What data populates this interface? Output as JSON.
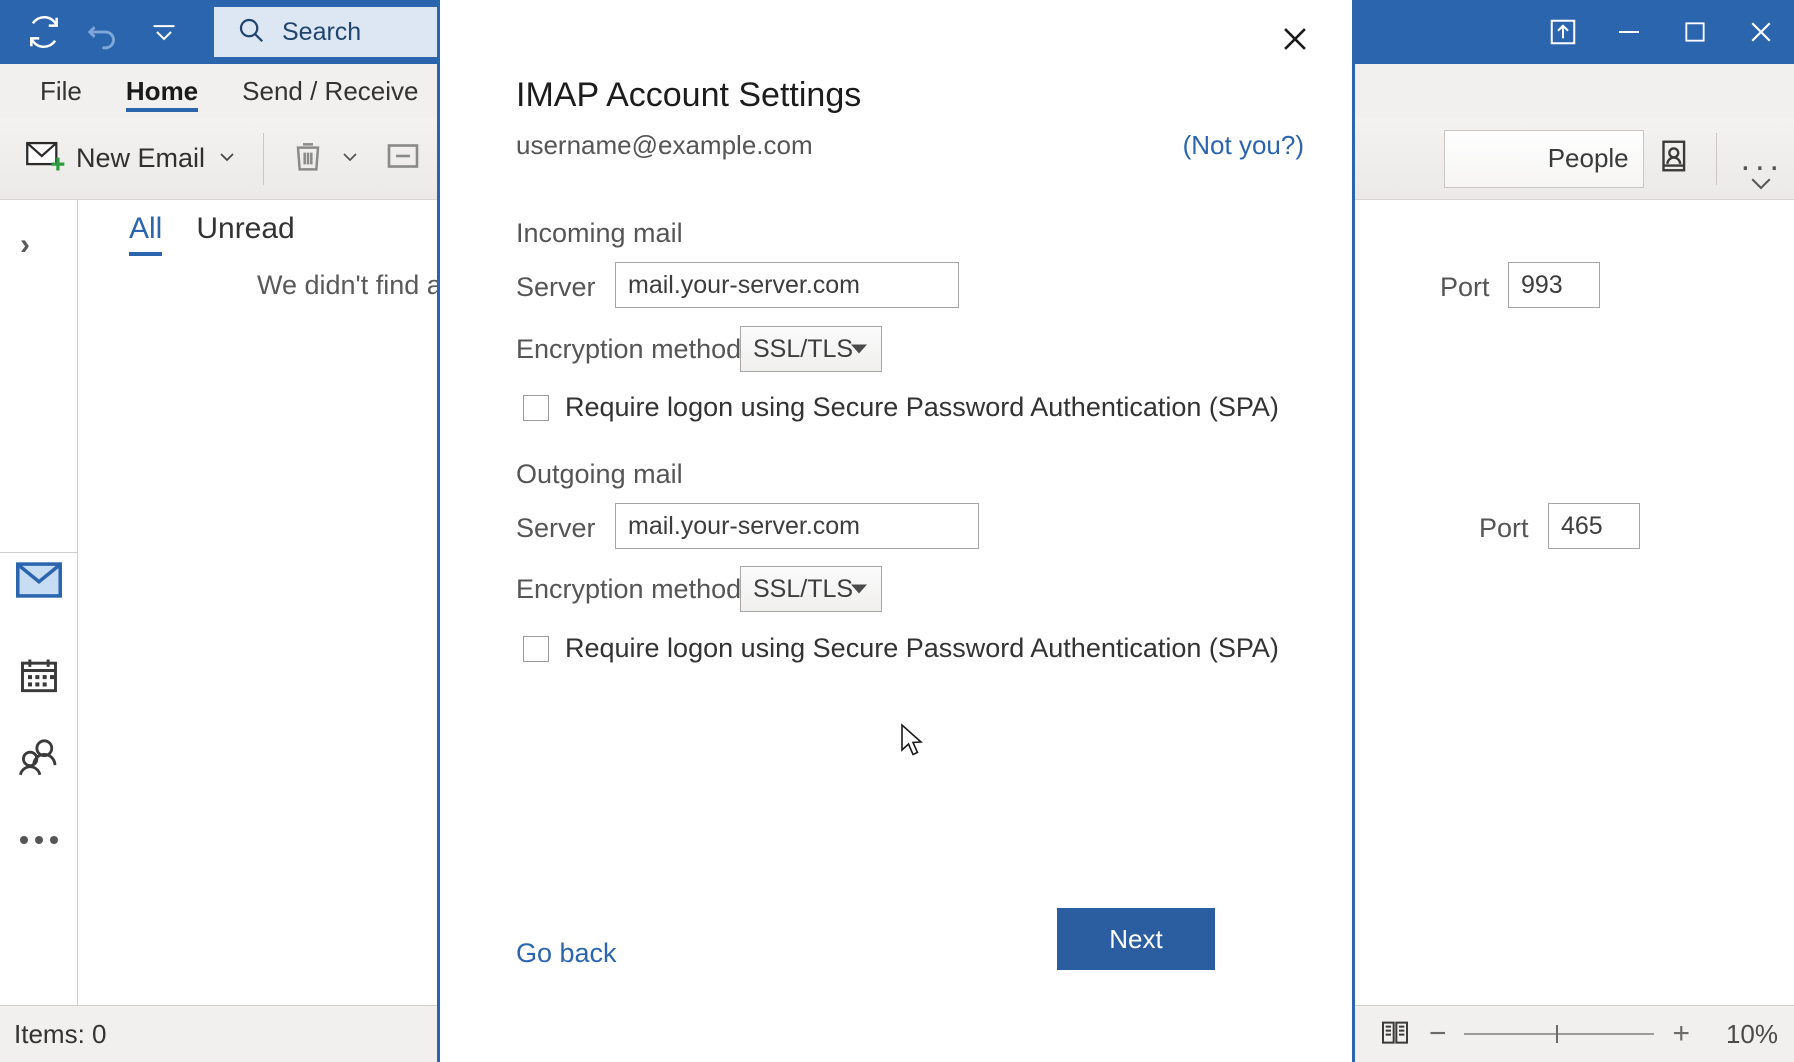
{
  "titlebar": {
    "quick_access": [
      {
        "name": "send-receive-all-icon",
        "label": "Send/Receive All Folders"
      },
      {
        "name": "undo-icon",
        "label": "Undo"
      },
      {
        "name": "customize-quick-access-toolbar-icon",
        "label": "Customize Quick Access Toolbar"
      }
    ],
    "search": {
      "placeholder": "Search",
      "value": "Search"
    },
    "window_controls": [
      {
        "name": "restore-down-ribbon-icon",
        "label": "Ribbon Display Options"
      },
      {
        "name": "minimize-icon",
        "label": "Minimize"
      },
      {
        "name": "maximize-icon",
        "label": "Maximize"
      },
      {
        "name": "close-icon",
        "label": "Close"
      }
    ]
  },
  "ribbon": {
    "tabs": [
      {
        "label": "File",
        "active": false
      },
      {
        "label": "Home",
        "active": true
      },
      {
        "label": "Send / Receive",
        "active": false
      }
    ],
    "new_email_label": "New Email",
    "people_label": "People",
    "overflow_label": "..."
  },
  "navrail": {
    "expand_label": "›",
    "items": [
      {
        "name": "mail-icon",
        "label": "Mail",
        "selected": true
      },
      {
        "name": "calendar-icon",
        "label": "Calendar",
        "selected": false
      },
      {
        "name": "people-icon",
        "label": "People",
        "selected": false
      },
      {
        "name": "more-options-icon",
        "label": "More",
        "selected": false
      }
    ]
  },
  "list_pane": {
    "filters": [
      {
        "label": "All",
        "active": true
      },
      {
        "label": "Unread",
        "active": false
      }
    ],
    "empty_message": "We didn't find anything to s"
  },
  "statusbar": {
    "items_label": "Items: 0",
    "reading_view_icon": "reading-view-icon",
    "zoom_minus": "−",
    "zoom_plus": "+",
    "zoom_level": "10%"
  },
  "dialog": {
    "close_label": "✕",
    "title": "IMAP Account Settings",
    "account_email": "username@example.com",
    "not_you_label": "(Not you?)",
    "incoming": {
      "section_label": "Incoming mail",
      "server_label": "Server",
      "server_value": "mail.your-server.com",
      "port_label": "Port",
      "port_value": "993",
      "encryption_label": "Encryption method",
      "encryption_value": "SSL/TLS",
      "spa_label": "Require logon using Secure Password Authentication (SPA)",
      "spa_checked": false
    },
    "outgoing": {
      "section_label": "Outgoing mail",
      "server_label": "Server",
      "server_value": "mail.your-server.com",
      "port_label": "Port",
      "port_value": "465",
      "encryption_label": "Encryption method",
      "encryption_value": "SSL/TLS",
      "spa_label": "Require logon using Secure Password Authentication (SPA)",
      "spa_checked": false
    },
    "go_back_label": "Go back",
    "next_label": "Next"
  },
  "colors": {
    "accent": "#2b65ae",
    "primary_button": "#2b5ea0",
    "ribbon_bg": "#f1f0ef",
    "search_bg": "#dce7f3"
  }
}
